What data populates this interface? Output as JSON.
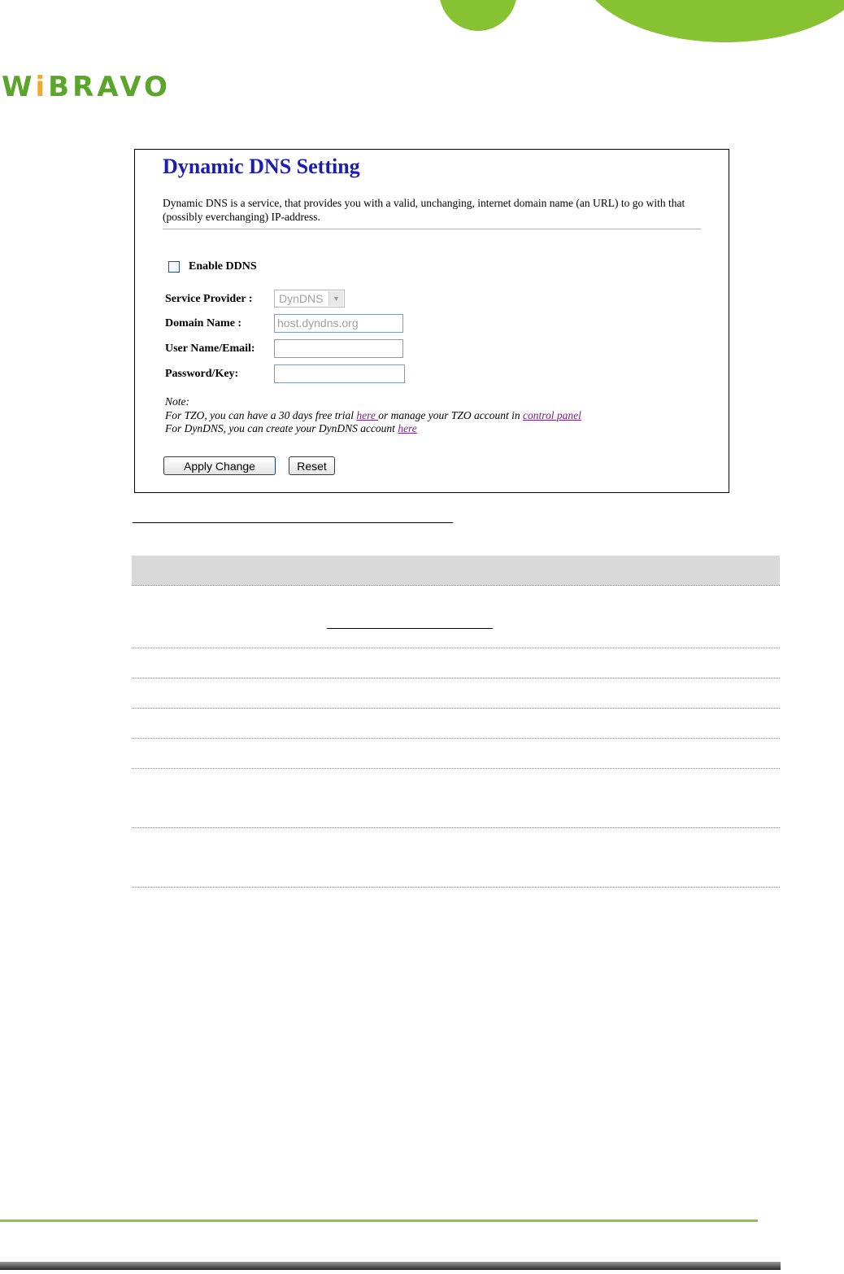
{
  "brand": {
    "logo_text_before_dot": "W",
    "logo_dot": "i",
    "logo_text_after_dot": "BRAVO"
  },
  "page": {
    "title": "Dynamic DNS  Setting",
    "description": "Dynamic DNS is a service, that provides you with a valid, unchanging, internet domain name (an URL) to go with that (possibly everchanging) IP-address."
  },
  "form": {
    "enable_label": "Enable DDNS",
    "enable_checked": false,
    "service_provider_label": "Service Provider :",
    "service_provider_value": "DynDNS",
    "domain_name_label": "Domain Name :",
    "domain_name_value": "host.dyndns.org",
    "username_label": "User Name/Email:",
    "username_value": "",
    "password_label": "Password/Key:",
    "password_value": ""
  },
  "note": {
    "heading": "Note:",
    "tzo_text_1": "For TZO, you can have a 30 days free trial ",
    "tzo_link_1": "here ",
    "tzo_text_2": "or manage your TZO account in ",
    "tzo_link_2": "control panel",
    "dyndns_text": "For DynDNS, you can create your DynDNS account ",
    "dyndns_link": "here"
  },
  "buttons": {
    "apply": "Apply Change",
    "reset": "Reset"
  },
  "colors": {
    "accent_green": "#86c232",
    "title_blue": "#1b1bb5",
    "link_purple": "#7a1f8f"
  }
}
